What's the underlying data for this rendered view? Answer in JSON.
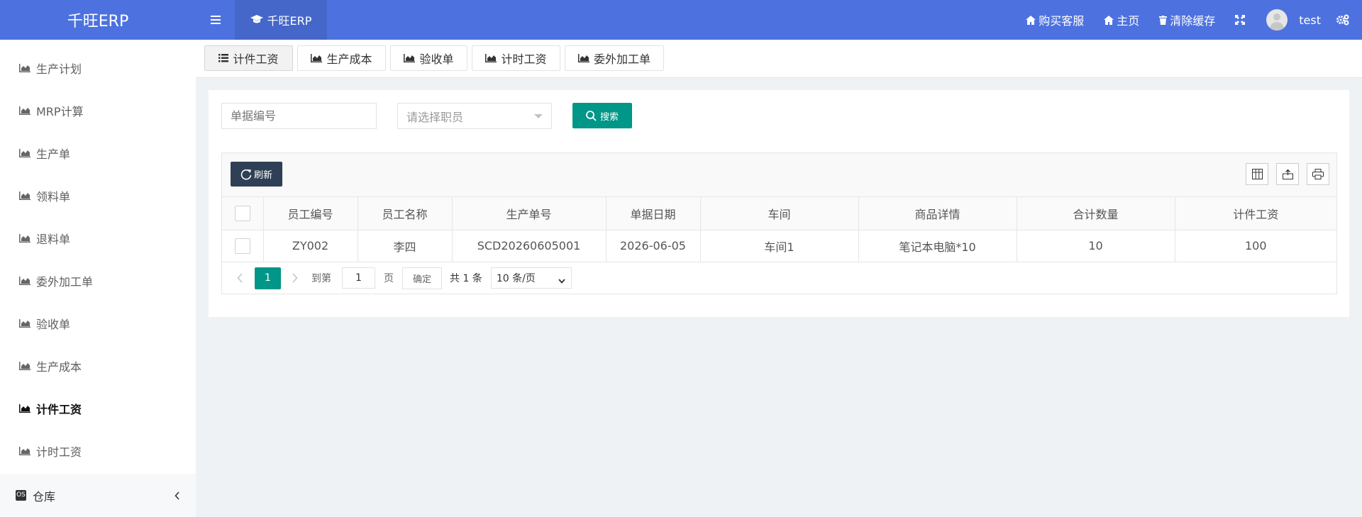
{
  "app": {
    "logo": "千旺ERP"
  },
  "topbar": {
    "active_tab": "千旺ERP",
    "buy_service": "购买客服",
    "home": "主页",
    "clear_cache": "清除缓存",
    "user": "test"
  },
  "sidebar": {
    "items": [
      {
        "label": "生产计划"
      },
      {
        "label": "MRP计算"
      },
      {
        "label": "生产单"
      },
      {
        "label": "领料单"
      },
      {
        "label": "退料单"
      },
      {
        "label": "委外加工单"
      },
      {
        "label": "验收单"
      },
      {
        "label": "生产成本"
      },
      {
        "label": "计件工资",
        "active": true
      },
      {
        "label": "计时工资"
      }
    ],
    "group": {
      "label": "仓库"
    }
  },
  "tabs": [
    {
      "label": "计件工资",
      "icon": "list-icon",
      "active": true
    },
    {
      "label": "生产成本",
      "icon": "chart-icon"
    },
    {
      "label": "验收单",
      "icon": "chart-icon"
    },
    {
      "label": "计时工资",
      "icon": "chart-icon"
    },
    {
      "label": "委外加工单",
      "icon": "chart-icon"
    }
  ],
  "search": {
    "doc_no_placeholder": "单据编号",
    "employee_placeholder": "请选择职员",
    "search_button": "搜索"
  },
  "toolbar": {
    "refresh": "刷新"
  },
  "table": {
    "columns": [
      "员工编号",
      "员工名称",
      "生产单号",
      "单据日期",
      "车间",
      "商品详情",
      "合计数量",
      "计件工资"
    ],
    "rows": [
      [
        "ZY002",
        "李四",
        "SCD20260605001",
        "2026-06-05",
        "车间1",
        "笔记本电脑*10",
        "10",
        "100"
      ]
    ]
  },
  "pager": {
    "current": "1",
    "goto_label": "到第",
    "goto_value": "1",
    "page_unit": "页",
    "confirm": "确定",
    "total": "共 1 条",
    "page_size": "10 条/页"
  },
  "colors": {
    "topbar": "#4d72df",
    "accent": "#009688",
    "refresh": "#2f4056"
  }
}
